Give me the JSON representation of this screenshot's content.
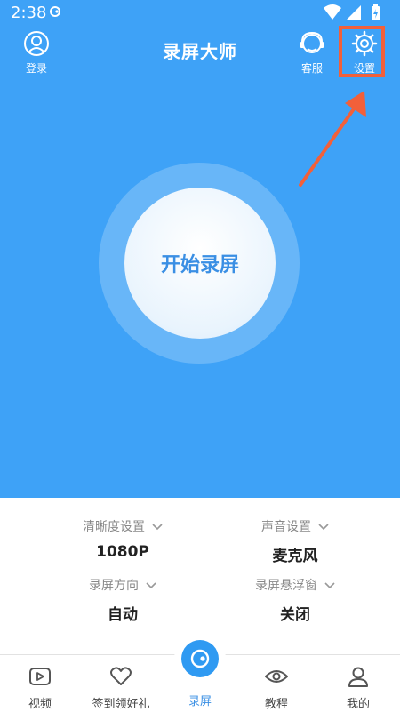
{
  "status_bar": {
    "time": "2:38"
  },
  "header": {
    "title": "录屏大师",
    "login_label": "登录",
    "service_label": "客服",
    "settings_label": "设置"
  },
  "record": {
    "label": "开始录屏"
  },
  "options": [
    {
      "title": "清晰度设置",
      "value": "1080P"
    },
    {
      "title": "声音设置",
      "value": "麦克风"
    },
    {
      "title": "录屏方向",
      "value": "自动"
    },
    {
      "title": "录屏悬浮窗",
      "value": "关闭"
    }
  ],
  "nav": [
    {
      "label": "视频"
    },
    {
      "label": "签到领好礼"
    },
    {
      "label": "录屏"
    },
    {
      "label": "教程"
    },
    {
      "label": "我的"
    }
  ],
  "colors": {
    "primary": "#3ea2f7",
    "accent": "#3a8fe4",
    "highlight": "#f2603a"
  }
}
